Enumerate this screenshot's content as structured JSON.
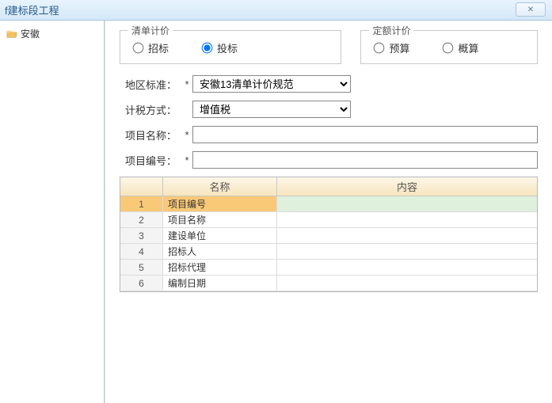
{
  "window": {
    "title": "f建标段工程"
  },
  "sidebar": {
    "items": [
      {
        "label": "安徽"
      }
    ]
  },
  "groups": {
    "list_pricing": {
      "legend": "清单计价",
      "options": [
        {
          "label": "招标",
          "checked": false
        },
        {
          "label": "投标",
          "checked": true
        }
      ]
    },
    "quota_pricing": {
      "legend": "定额计价",
      "options": [
        {
          "label": "预算",
          "checked": false
        },
        {
          "label": "概算",
          "checked": false
        }
      ]
    }
  },
  "form": {
    "region_std": {
      "label": "地区标准：",
      "value": "安徽13清单计价规范"
    },
    "tax_method": {
      "label": "计税方式：",
      "value": "增值税"
    },
    "proj_name": {
      "label": "项目名称：",
      "value": ""
    },
    "proj_no": {
      "label": "项目编号：",
      "value": ""
    },
    "req_mark": "*"
  },
  "grid": {
    "headers": {
      "num": "",
      "name": "名称",
      "content": "内容"
    },
    "rows": [
      {
        "num": "1",
        "name": "项目编号",
        "content": ""
      },
      {
        "num": "2",
        "name": "项目名称",
        "content": ""
      },
      {
        "num": "3",
        "name": "建设单位",
        "content": ""
      },
      {
        "num": "4",
        "name": "招标人",
        "content": ""
      },
      {
        "num": "5",
        "name": "招标代理",
        "content": ""
      },
      {
        "num": "6",
        "name": "编制日期",
        "content": ""
      }
    ]
  }
}
